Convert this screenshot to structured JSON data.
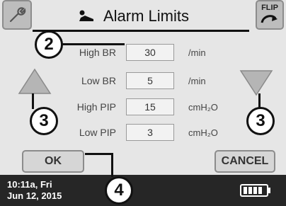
{
  "header": {
    "title": "Alarm Limits",
    "left_icon": "wrench-icon",
    "flip_label": "FLIP"
  },
  "rows": [
    {
      "label": "High BR",
      "value": "30",
      "unit": "/min"
    },
    {
      "label": "Low BR",
      "value": "5",
      "unit": "/min"
    },
    {
      "label": "High PIP",
      "value": "15",
      "unit": "cmH₂O"
    },
    {
      "label": "Low PIP",
      "value": "3",
      "unit": "cmH₂O"
    }
  ],
  "buttons": {
    "ok": "OK",
    "cancel": "CANCEL"
  },
  "status": {
    "time": "10:11a, Fri",
    "date": "Jun 12, 2015",
    "battery_level": 1.0
  },
  "callouts": {
    "a": "2",
    "b": "3",
    "c": "3",
    "d": "4"
  },
  "colors": {
    "background": "#e6e6e6",
    "statusbar": "#262626",
    "arrow": "#b5b5b5"
  }
}
